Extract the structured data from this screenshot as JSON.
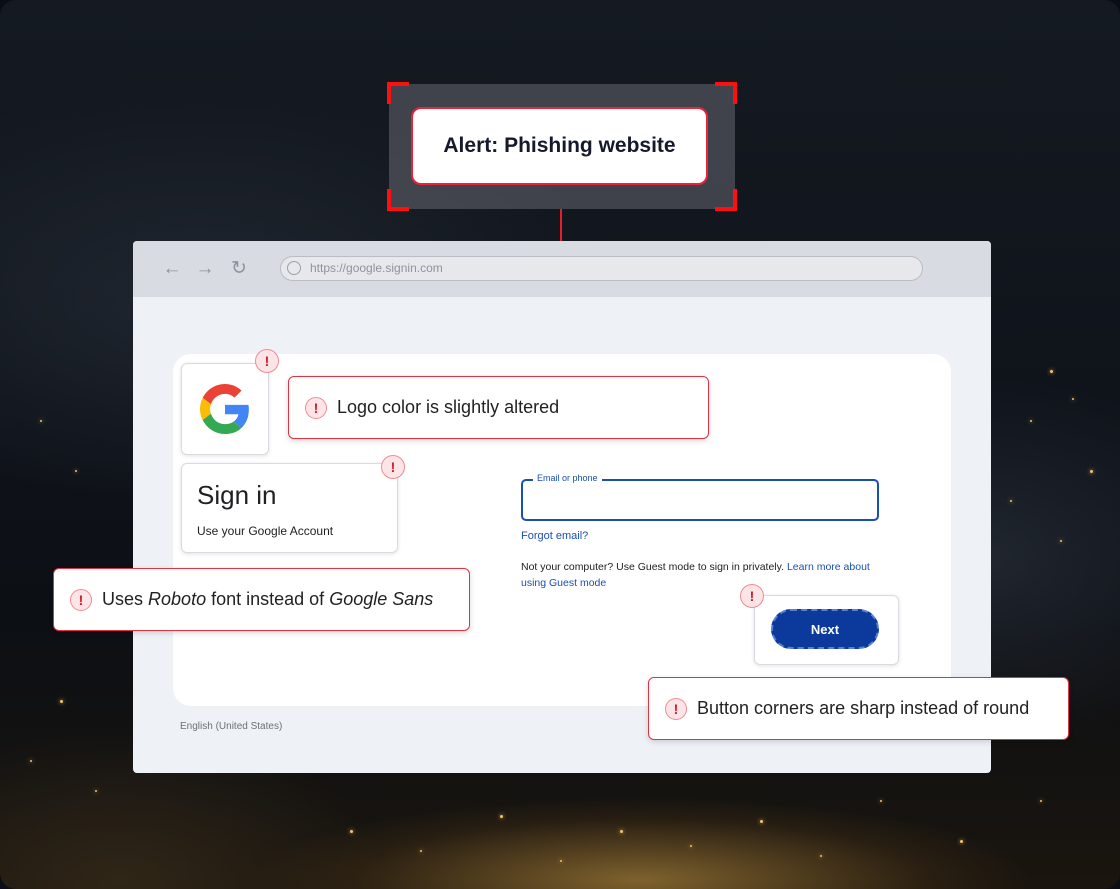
{
  "alert": {
    "title": "Alert: Phishing website"
  },
  "browser": {
    "url": "https://google.signin.com",
    "nav_icons": [
      "back-arrow-icon",
      "forward-arrow-icon",
      "reload-icon"
    ]
  },
  "signin": {
    "title": "Sign in",
    "subtitle": "Use your Google Account",
    "email_label": "Email or phone",
    "forgot_email": "Forgot email?",
    "guest_text": "Not your computer? Use Guest mode to sign in privately.",
    "guest_link": "Learn more about using Guest mode",
    "next_button": "Next",
    "language": "English (United States)"
  },
  "callouts": {
    "logo": "Logo color is slightly altered",
    "font_prefix": "Uses",
    "font_actual": "Roboto",
    "font_middle": "font instead of",
    "font_expected": "Google Sans",
    "button": "Button corners are sharp instead of round"
  },
  "colors": {
    "alert_red": "#e8233a",
    "button_blue": "#0b3a9c",
    "link_blue": "#1a4fb0"
  }
}
